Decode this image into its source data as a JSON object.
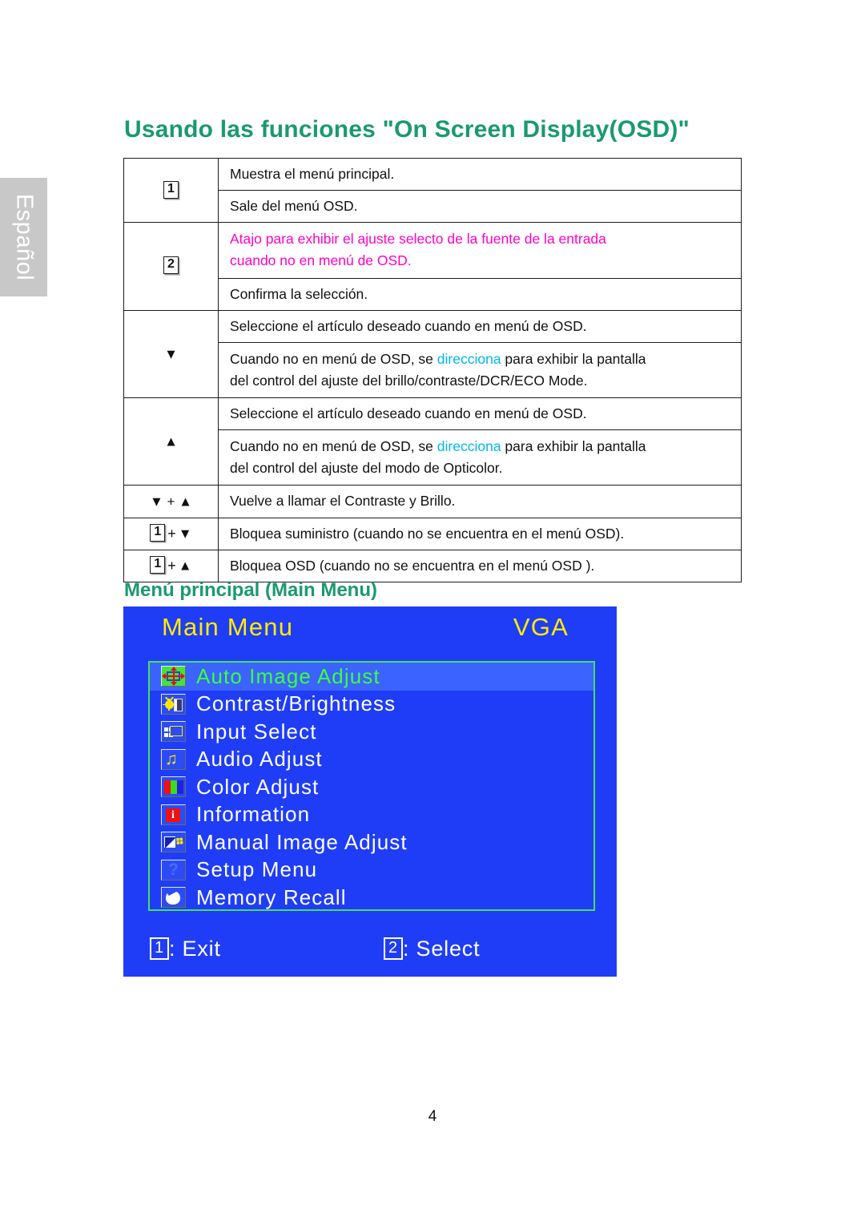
{
  "language_tab": {
    "label": "Español"
  },
  "page_title": "Usando las funciones \"On Screen Display(OSD)\"",
  "key_table": {
    "rows": [
      {
        "key_type": "numbox",
        "key": "1",
        "key_rowspan": 2,
        "lines": [
          {
            "text": "Muestra el menú principal."
          }
        ]
      },
      {
        "key_type": "none",
        "lines": [
          {
            "text": "Sale del menú OSD."
          }
        ]
      },
      {
        "key_type": "numbox",
        "key": "2",
        "key_rowspan": 2,
        "lines": [
          {
            "text": "Atajo para exhibir el ajuste selecto de la fuente de la entrada",
            "color": "magenta"
          },
          {
            "text": "cuando no en menú de OSD.",
            "color": "magenta"
          }
        ]
      },
      {
        "key_type": "none",
        "lines": [
          {
            "text": "Confirma la selección."
          }
        ]
      },
      {
        "key_type": "none",
        "lines": [
          {
            "text": "Seleccione el artículo deseado cuando en menú de OSD."
          }
        ]
      },
      {
        "key_type": "arrow-down",
        "key": "▼",
        "lines": [
          {
            "pre": "Cuando no en menú de OSD, se ",
            "hl": "direcciona",
            "post": " para exhibir la pantalla",
            "color": "cyan"
          },
          {
            "text": "del control del ajuste del brillo/contraste/DCR/ECO Mode."
          }
        ]
      },
      {
        "key_type": "none",
        "lines": [
          {
            "text": "Seleccione el artículo deseado cuando en menú de OSD."
          }
        ]
      },
      {
        "key_type": "arrow-up",
        "key": "▲",
        "lines": [
          {
            "pre": "Cuando no en menú de OSD, se ",
            "hl": "direcciona",
            "post": " para exhibir la pantalla",
            "color": "cyan"
          },
          {
            "text": "del control del ajuste del modo de Opticolor."
          }
        ]
      },
      {
        "key_type": "combo-arrows",
        "key": "▼ + ▲",
        "lines": [
          {
            "text": "Vuelve a llamar el Contraste y Brillo."
          }
        ]
      },
      {
        "key_type": "combo-num-down",
        "key": "1 + ▼",
        "lines": [
          {
            "text": "Bloquea suministro (cuando no se encuentra en el menú OSD)."
          }
        ]
      },
      {
        "key_type": "combo-num-up",
        "key": "1 + ▲",
        "lines": [
          {
            "text": "Bloquea OSD (cuando no se encuentra en el menú OSD )."
          }
        ]
      }
    ]
  },
  "sub_title": "Menú principal (Main Menu)",
  "osd": {
    "title": "Main Menu",
    "source": "VGA",
    "items": [
      {
        "label": "Auto Image Adjust",
        "icon": "auto-image-adjust-icon",
        "selected": true
      },
      {
        "label": "Contrast/Brightness",
        "icon": "contrast-brightness-icon",
        "selected": false
      },
      {
        "label": "Input Select",
        "icon": "input-select-icon",
        "selected": false
      },
      {
        "label": "Audio Adjust",
        "icon": "audio-adjust-icon",
        "selected": false
      },
      {
        "label": "Color Adjust",
        "icon": "color-adjust-icon",
        "selected": false
      },
      {
        "label": "Information",
        "icon": "information-icon",
        "selected": false
      },
      {
        "label": "Manual Image Adjust",
        "icon": "manual-image-adjust-icon",
        "selected": false
      },
      {
        "label": "Setup Menu",
        "icon": "setup-menu-icon",
        "selected": false
      },
      {
        "label": "Memory Recall",
        "icon": "memory-recall-icon",
        "selected": false
      }
    ],
    "footer": {
      "exit_key": "1",
      "exit_label": ": Exit",
      "select_key": "2",
      "select_label": ": Select"
    }
  },
  "page_number": "4",
  "colors": {
    "heading_green": "#1a9a6e",
    "osd_blue": "#1f3df7",
    "osd_yellow": "#ffec00",
    "osd_green_border": "#44e05a",
    "selected_green_text": "#3dff3d",
    "magenta": "#ff00c8",
    "cyan": "#00b7f0",
    "tab_gray": "#c8c8c8"
  }
}
